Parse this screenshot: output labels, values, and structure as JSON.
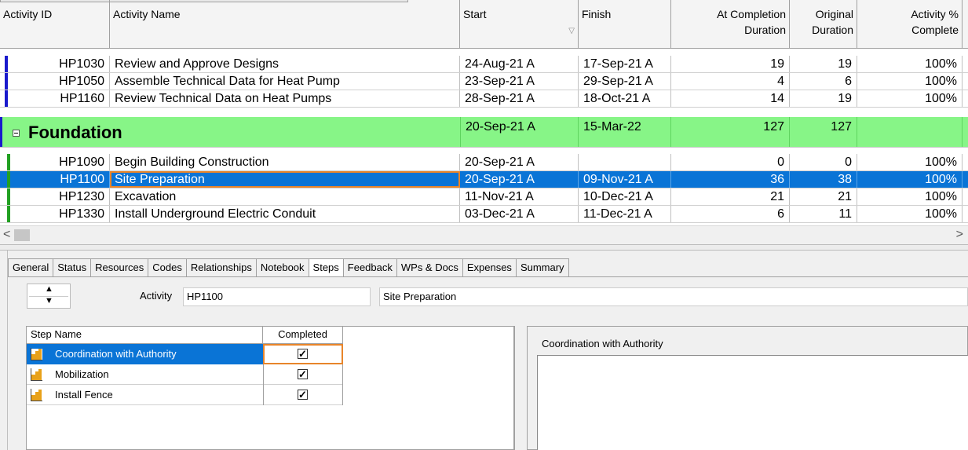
{
  "columns": {
    "activity_id": "Activity ID",
    "activity_name": "Activity Name",
    "start": "Start",
    "finish": "Finish",
    "at_completion_1": "At Completion",
    "at_completion_2": "Duration",
    "original_1": "Original",
    "original_2": "Duration",
    "pct_1": "Activity %",
    "pct_2": "Complete"
  },
  "rows": [
    {
      "id": "HP1030",
      "name": "Review and Approve Designs",
      "start": "24-Aug-21 A",
      "finish": "17-Sep-21 A",
      "atc": "19",
      "orig": "19",
      "pct": "100%"
    },
    {
      "id": "HP1050",
      "name": "Assemble Technical Data for Heat Pump",
      "start": "23-Sep-21 A",
      "finish": "29-Sep-21 A",
      "atc": "4",
      "orig": "6",
      "pct": "100%"
    },
    {
      "id": "HP1160",
      "name": "Review Technical Data on Heat Pumps",
      "start": "28-Sep-21 A",
      "finish": "18-Oct-21 A",
      "atc": "14",
      "orig": "19",
      "pct": "100%"
    }
  ],
  "group": {
    "name": "Foundation",
    "start": "20-Sep-21 A",
    "finish": "15-Mar-22",
    "atc": "127",
    "orig": "127"
  },
  "rows2": [
    {
      "id": "HP1090",
      "name": "Begin Building Construction",
      "start": "20-Sep-21 A",
      "finish": "",
      "atc": "0",
      "orig": "0",
      "pct": "100%"
    },
    {
      "id": "HP1100",
      "name": "Site Preparation",
      "start": "20-Sep-21 A",
      "finish": "09-Nov-21 A",
      "atc": "36",
      "orig": "38",
      "pct": "100%"
    },
    {
      "id": "HP1230",
      "name": "Excavation",
      "start": "11-Nov-21 A",
      "finish": "10-Dec-21 A",
      "atc": "21",
      "orig": "21",
      "pct": "100%"
    },
    {
      "id": "HP1330",
      "name": "Install Underground Electric Conduit",
      "start": "03-Dec-21 A",
      "finish": "11-Dec-21 A",
      "atc": "6",
      "orig": "11",
      "pct": "100%"
    }
  ],
  "scroll": {
    "left": "<",
    "right": ">"
  },
  "tabs": [
    "General",
    "Status",
    "Resources",
    "Codes",
    "Relationships",
    "Notebook",
    "Steps",
    "Feedback",
    "WPs & Docs",
    "Expenses",
    "Summary"
  ],
  "active_tab": "Steps",
  "activity": {
    "label": "Activity",
    "id": "HP1100",
    "name": "Site Preparation"
  },
  "steps_grid": {
    "header_name": "Step Name",
    "header_completed": "Completed",
    "steps": [
      {
        "name": "Coordination with Authority",
        "completed": true
      },
      {
        "name": "Mobilization",
        "completed": true
      },
      {
        "name": "Install Fence",
        "completed": true
      }
    ]
  },
  "notes": {
    "title": "Coordination with Authority"
  },
  "colors": {
    "selection": "#0a74d6",
    "group_bg": "#87f587",
    "focus": "#e8852a",
    "wbs_bar": "#1a1acc"
  }
}
